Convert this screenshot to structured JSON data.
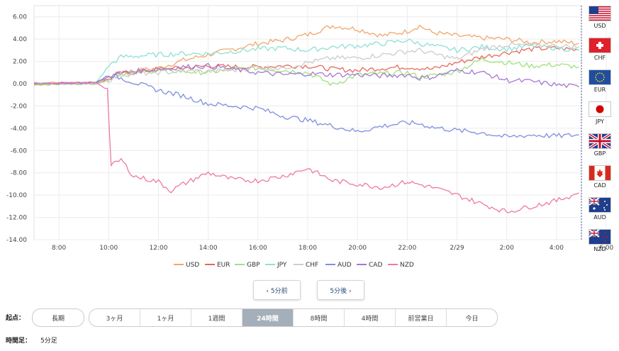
{
  "chart_data": {
    "type": "line",
    "ylim": [
      -14,
      7
    ],
    "y_ticks": [
      "6.00",
      "4.00",
      "2.00",
      "0.00",
      "-2.00",
      "-4.00",
      "-6.00",
      "-8.00",
      "-10.00",
      "-12.00",
      "-14.00"
    ],
    "x_ticks": [
      "8:00",
      "10:00",
      "12:00",
      "14:00",
      "16:00",
      "18:00",
      "20:00",
      "22:00",
      "2/29",
      "2:00",
      "4:00",
      "6:00"
    ],
    "x_range_hours": [
      7,
      29
    ],
    "grid": true,
    "legend_position": "bottom",
    "series": [
      {
        "name": "USD",
        "color": "#f2a66b",
        "x": [
          7.0,
          9.5,
          10.0,
          10.5,
          12,
          13,
          14,
          15,
          16,
          17,
          18,
          19,
          20,
          21,
          22,
          22.5,
          23,
          24,
          25,
          26,
          27,
          28,
          28.9
        ],
        "values": [
          0.1,
          0.1,
          0.6,
          1.0,
          1.4,
          2.1,
          2.6,
          3.1,
          3.6,
          3.9,
          4.4,
          5.2,
          4.9,
          4.3,
          4.7,
          5.2,
          4.6,
          4.3,
          4.1,
          4.0,
          3.7,
          3.8,
          3.6
        ]
      },
      {
        "name": "EUR",
        "color": "#e8685a",
        "x": [
          7.0,
          9.5,
          10.0,
          10.5,
          12,
          13,
          14,
          15,
          16,
          17,
          18,
          19,
          20,
          21,
          22,
          22.5,
          23,
          24,
          25,
          26,
          27,
          28,
          28.9
        ],
        "values": [
          0.0,
          0.1,
          0.4,
          0.9,
          1.3,
          1.4,
          1.6,
          1.5,
          1.5,
          1.6,
          1.6,
          1.3,
          1.2,
          1.4,
          1.5,
          1.4,
          1.3,
          1.9,
          2.4,
          2.8,
          3.1,
          3.2,
          3.0
        ]
      },
      {
        "name": "GBP",
        "color": "#9ee27a",
        "x": [
          7.0,
          9.5,
          10.0,
          10.5,
          12,
          13,
          14,
          15,
          16,
          17,
          18,
          19,
          20,
          21,
          22,
          22.5,
          23,
          24,
          25,
          26,
          27,
          28,
          28.9
        ],
        "values": [
          -0.1,
          0.0,
          0.4,
          0.9,
          1.2,
          1.1,
          1.0,
          1.3,
          1.4,
          1.2,
          1.0,
          -0.1,
          0.8,
          0.9,
          1.0,
          0.6,
          0.7,
          1.1,
          2.2,
          1.9,
          1.6,
          1.7,
          1.5
        ]
      },
      {
        "name": "JPY",
        "color": "#8fe0d4",
        "x": [
          7.0,
          9.5,
          10.0,
          10.5,
          12,
          13,
          14,
          15,
          16,
          17,
          18,
          19,
          20,
          21,
          22,
          22.5,
          23,
          24,
          25,
          26,
          27,
          28,
          28.9
        ],
        "values": [
          0.0,
          0.1,
          1.6,
          2.4,
          2.6,
          2.7,
          2.7,
          2.9,
          3.1,
          3.2,
          3.0,
          3.3,
          3.4,
          3.6,
          3.9,
          3.6,
          3.4,
          3.0,
          3.3,
          3.1,
          3.4,
          3.2,
          3.0
        ]
      },
      {
        "name": "CHF",
        "color": "#cccccc",
        "x": [
          7.0,
          9.5,
          10.0,
          10.5,
          12,
          13,
          14,
          15,
          16,
          17,
          18,
          19,
          20,
          21,
          22,
          22.5,
          23,
          24,
          25,
          26,
          27,
          28,
          28.9
        ],
        "values": [
          0.0,
          0.0,
          0.3,
          0.8,
          1.0,
          1.1,
          1.1,
          1.2,
          1.5,
          1.4,
          1.9,
          2.3,
          2.3,
          2.6,
          2.9,
          3.0,
          2.7,
          2.2,
          3.1,
          3.5,
          3.4,
          3.4,
          3.3
        ]
      },
      {
        "name": "AUD",
        "color": "#7d8fe0",
        "x": [
          7.0,
          9.5,
          10.0,
          10.5,
          12,
          13,
          14,
          15,
          16,
          17,
          18,
          19,
          20,
          21,
          22,
          22.5,
          23,
          24,
          25,
          26,
          27,
          28,
          28.9
        ],
        "values": [
          0.0,
          0.1,
          0.8,
          0.5,
          -0.6,
          -1.1,
          -1.8,
          -2.0,
          -2.2,
          -2.9,
          -3.3,
          -3.8,
          -4.3,
          -3.8,
          -3.5,
          -3.6,
          -3.9,
          -4.2,
          -4.4,
          -4.8,
          -4.6,
          -4.7,
          -4.6
        ]
      },
      {
        "name": "CAD",
        "color": "#a577d6",
        "x": [
          7.0,
          9.5,
          10.0,
          10.5,
          12,
          13,
          14,
          15,
          16,
          17,
          18,
          19,
          20,
          21,
          22,
          22.5,
          23,
          24,
          25,
          26,
          27,
          28,
          28.9
        ],
        "values": [
          0.0,
          0.1,
          0.6,
          1.0,
          1.3,
          1.5,
          1.6,
          1.3,
          1.0,
          0.8,
          0.9,
          0.8,
          0.8,
          0.7,
          0.8,
          0.5,
          0.6,
          1.2,
          1.0,
          0.3,
          0.2,
          -0.1,
          -0.3
        ]
      },
      {
        "name": "NZD",
        "color": "#ee78a6",
        "x": [
          7.0,
          9.5,
          9.95,
          10.1,
          10.5,
          11,
          12,
          12.5,
          13,
          14,
          15,
          16,
          17,
          18,
          19,
          20,
          21,
          22,
          23,
          24,
          25,
          26,
          27,
          28,
          28.9
        ],
        "values": [
          0.0,
          0.1,
          -0.5,
          -7.4,
          -6.8,
          -8.3,
          -8.8,
          -9.6,
          -9.0,
          -8.0,
          -8.6,
          -8.7,
          -8.3,
          -7.6,
          -8.7,
          -9.0,
          -9.3,
          -8.8,
          -9.3,
          -10.0,
          -10.8,
          -11.5,
          -11.0,
          -10.5,
          -9.8
        ]
      }
    ]
  },
  "flags": [
    {
      "code": "USD"
    },
    {
      "code": "CHF"
    },
    {
      "code": "EUR"
    },
    {
      "code": "JPY"
    },
    {
      "code": "GBP"
    },
    {
      "code": "CAD"
    },
    {
      "code": "AUD"
    },
    {
      "code": "NZD"
    }
  ],
  "nav": {
    "prev_label": "‹ 5分前",
    "next_label": "5分後 ›"
  },
  "controls": {
    "start_label": "起点：",
    "long_term_label": "長期",
    "periods": [
      "3ヶ月",
      "1ヶ月",
      "1週間",
      "24時間",
      "8時間",
      "4時間",
      "前営業日",
      "今日"
    ],
    "active_period": "24時間",
    "timeframe_label": "時間足：",
    "timeframe_value": "5分足"
  }
}
